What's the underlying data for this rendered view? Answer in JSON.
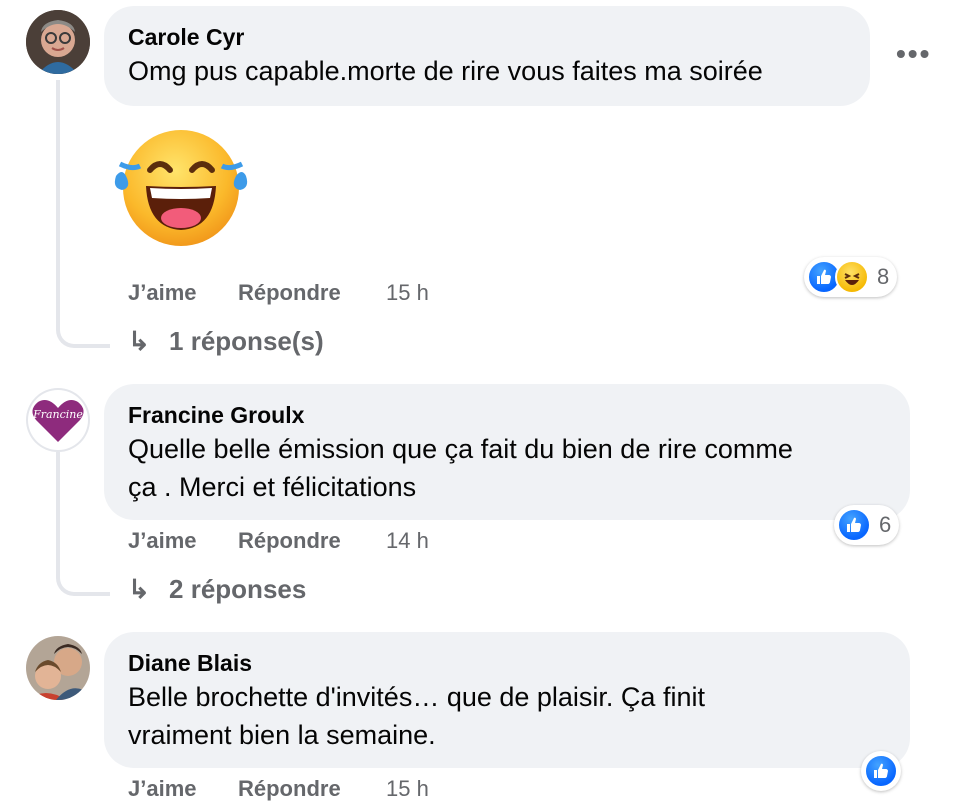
{
  "comments": [
    {
      "author": "Carole Cyr",
      "text": "Omg pus capable.morte de rire vous faites ma soirée",
      "actions": {
        "like": "J’aime",
        "reply": "Répondre",
        "time": "15 h"
      },
      "reactions": {
        "types": [
          "like-icon",
          "haha-icon"
        ],
        "count": "8"
      },
      "replies": "1 réponse(s)",
      "sticker": "laughing-tears-emoji"
    },
    {
      "author": "Francine Groulx",
      "avatar_label": "Francine",
      "text_lines": [
        "Quelle belle émission que ça fait du bien de rire comme",
        "ça . Merci et félicitations"
      ],
      "actions": {
        "like": "J’aime",
        "reply": "Répondre",
        "time": "14 h"
      },
      "reactions": {
        "types": [
          "like-icon"
        ],
        "count": "6"
      },
      "replies": "2 réponses"
    },
    {
      "author": "Diane Blais",
      "text_lines": [
        "Belle brochette d'invités… que de plaisir. Ça finit",
        "vraiment bien la semaine."
      ],
      "actions": {
        "like": "J’aime",
        "reply": "Répondre",
        "time": "15 h"
      },
      "reactions": {
        "types": [
          "like-icon"
        ],
        "count": ""
      }
    }
  ],
  "icons": {
    "more": "more-options-icon",
    "reply_arrow": "reply-arrow-icon"
  },
  "colors": {
    "bubble": "#f0f2f5",
    "secondary_text": "#65676b",
    "like_blue": "#0866ff",
    "francine_heart": "#8e2b7d"
  }
}
